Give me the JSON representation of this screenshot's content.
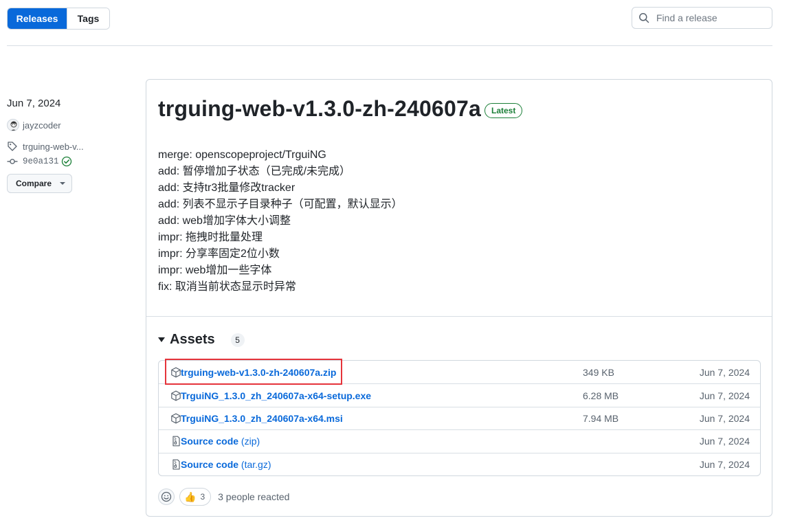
{
  "top_bar": {
    "tabs": [
      {
        "label": "Releases",
        "active": true
      },
      {
        "label": "Tags",
        "active": false
      }
    ],
    "search_placeholder": "Find a release"
  },
  "meta": {
    "date": "Jun 7, 2024",
    "author": "jayzcoder",
    "tag": "trguing-web-v...",
    "commit": "9e0a131",
    "compare_label": "Compare"
  },
  "release": {
    "title": "trguing-web-v1.3.0-zh-240607a",
    "badge": "Latest",
    "notes": [
      "merge: openscopeproject/TrguiNG",
      "add: 暂停增加子状态（已完成/未完成）",
      "add: 支持tr3批量修改tracker",
      "add: 列表不显示子目录种子（可配置，默认显示）",
      "add: web增加字体大小调整",
      "impr: 拖拽时批量处理",
      "impr: 分享率固定2位小数",
      "impr: web增加一些字体",
      "fix: 取消当前状态显示时异常"
    ]
  },
  "assets": {
    "label": "Assets",
    "count": "5",
    "items": [
      {
        "name": "trguing-web-v1.3.0-zh-240607a.zip",
        "suffix": "",
        "size": "349 KB",
        "date": "Jun 7, 2024",
        "icon": "package-icon"
      },
      {
        "name": "TrguiNG_1.3.0_zh_240607a-x64-setup.exe",
        "suffix": "",
        "size": "6.28 MB",
        "date": "Jun 7, 2024",
        "icon": "package-icon"
      },
      {
        "name": "TrguiNG_1.3.0_zh_240607a-x64.msi",
        "suffix": "",
        "size": "7.94 MB",
        "date": "Jun 7, 2024",
        "icon": "package-icon"
      },
      {
        "name": "Source code",
        "suffix": " (zip)",
        "size": "",
        "date": "Jun 7, 2024",
        "icon": "file-zip-icon"
      },
      {
        "name": "Source code",
        "suffix": " (tar.gz)",
        "size": "",
        "date": "Jun 7, 2024",
        "icon": "file-zip-icon"
      }
    ]
  },
  "reactions": {
    "emoji": "👍",
    "count": "3",
    "summary": "3 people reacted"
  },
  "colors": {
    "accent": "#0969da",
    "latest_green": "#1a7f37",
    "highlight_red": "#e5333a"
  }
}
